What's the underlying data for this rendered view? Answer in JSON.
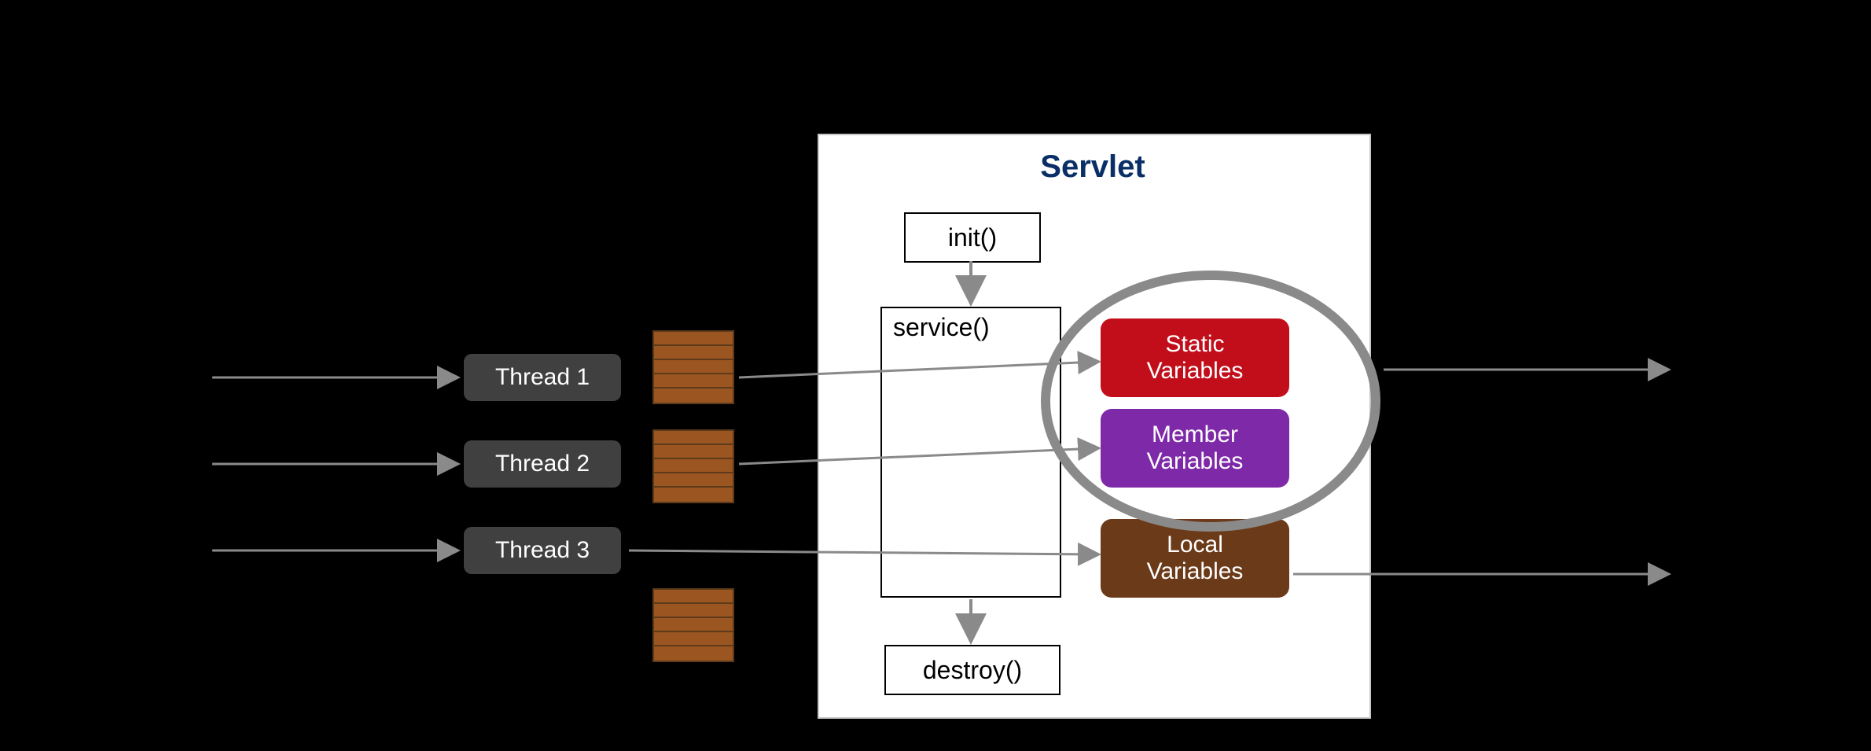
{
  "threads": {
    "t1": "Thread 1",
    "t2": "Thread 2",
    "t3": "Thread 3"
  },
  "servlet": {
    "title": "Servlet",
    "init": "init()",
    "service": "service()",
    "destroy": "destroy()"
  },
  "variables": {
    "static_label": "Static\nVariables",
    "member_label": "Member\nVariables",
    "local_label": "Local\nVariables"
  },
  "colors": {
    "static": "#c20e1a",
    "member": "#7d29a8",
    "local": "#6b3a18"
  }
}
